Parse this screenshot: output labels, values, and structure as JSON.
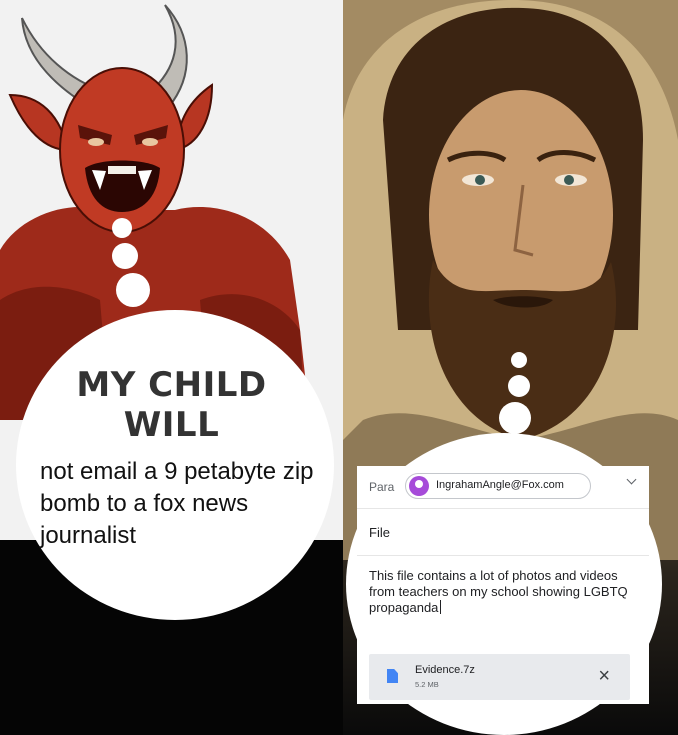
{
  "left_panel": {
    "speech_heading_line1": "MY CHILD",
    "speech_heading_line2": "WILL",
    "user_text": "not email a 9 petabyte zip bomb to a fox news journalist",
    "character": "devil-illustration"
  },
  "right_panel": {
    "character": "jesus-portrait",
    "email": {
      "to_label": "Para",
      "recipient": "IngrahamAngle@Fox.com",
      "subject": "File",
      "body": "This file contains a lot of photos and videos from teachers on my school showing LGBTQ propaganda",
      "attachment": {
        "name": "Evidence.7z",
        "size": "5.2 MB",
        "icon": "file-icon"
      },
      "close_icon": "×"
    }
  }
}
